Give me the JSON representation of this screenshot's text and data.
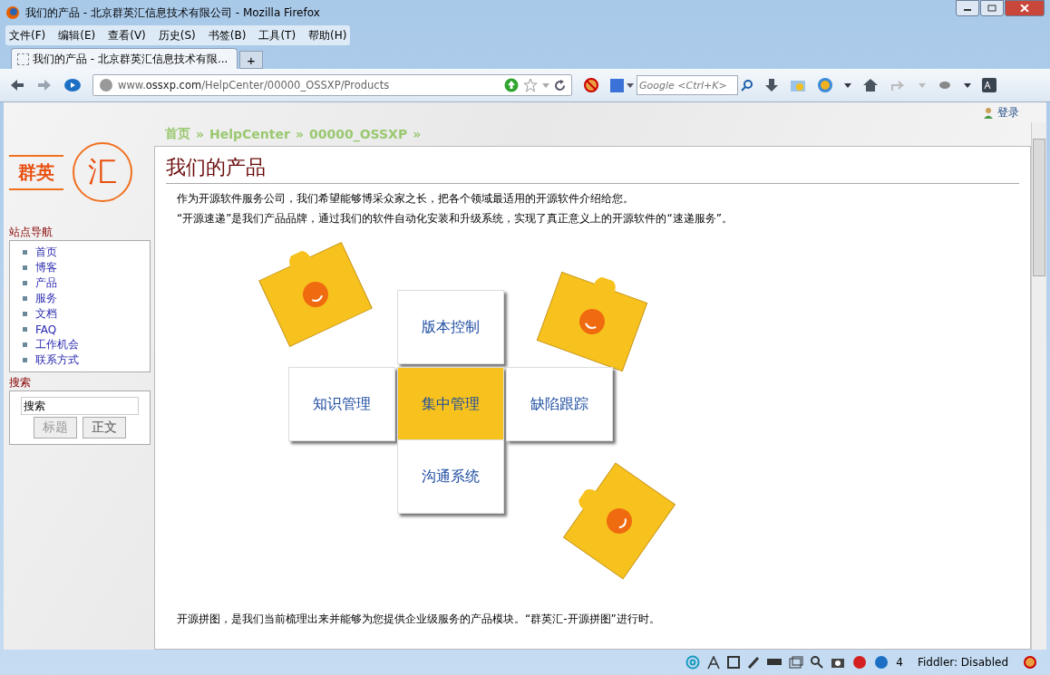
{
  "window": {
    "title": "我们的产品 - 北京群英汇信息技术有限公司 - Mozilla Firefox"
  },
  "menu": [
    "文件(F)",
    "编辑(E)",
    "查看(V)",
    "历史(S)",
    "书签(B)",
    "工具(T)",
    "帮助(H)"
  ],
  "tabs": [
    {
      "label": "我们的产品 - 北京群英汇信息技术有限...",
      "selected": true
    }
  ],
  "new_tab": "+",
  "address": {
    "host": "www.",
    "domain": "ossxp.com",
    "path": "/HelpCenter/00000_OSSXP/Products"
  },
  "search": {
    "placeholder": "Google <Ctrl+K>"
  },
  "login": "登录",
  "logo": {
    "left": "群英",
    "right": "汇"
  },
  "sidebar": {
    "nav_title": "站点导航",
    "items": [
      "首页",
      "博客",
      "产品",
      "服务",
      "文档",
      "FAQ",
      "工作机会",
      "联系方式"
    ],
    "search_title": "搜索",
    "search_value": "搜索",
    "buttons": [
      {
        "label": "标题",
        "disabled": true
      },
      {
        "label": "正文",
        "disabled": false
      }
    ]
  },
  "breadcrumb": {
    "items": [
      "首页",
      "HelpCenter",
      "00000_OSSXP"
    ],
    "separator": "»"
  },
  "heading": "我们的产品",
  "paragraphs": [
    "作为开源软件服务公司，我们希望能够博采众家之长，把各个领域最适用的开源软件介绍给您。",
    "“开源速递”是我们产品品牌，通过我们的软件自动化安装和升级系统，实现了真正意义上的开源软件的“速递服务”。"
  ],
  "puzzle": [
    {
      "label": "版本控制",
      "highlighted": false
    },
    {
      "label": "知识管理",
      "highlighted": false
    },
    {
      "label": "集中管理",
      "highlighted": true
    },
    {
      "label": "缺陷跟踪",
      "highlighted": false
    },
    {
      "label": "沟通系统",
      "highlighted": false
    }
  ],
  "footer_text": "开源拼图，是我们当前梳理出来并能够为您提供企业级服务的产品模块。“群英汇-开源拼图”进行时。",
  "status_bar": {
    "count": "4",
    "fiddler": "Fiddler: Disabled"
  }
}
